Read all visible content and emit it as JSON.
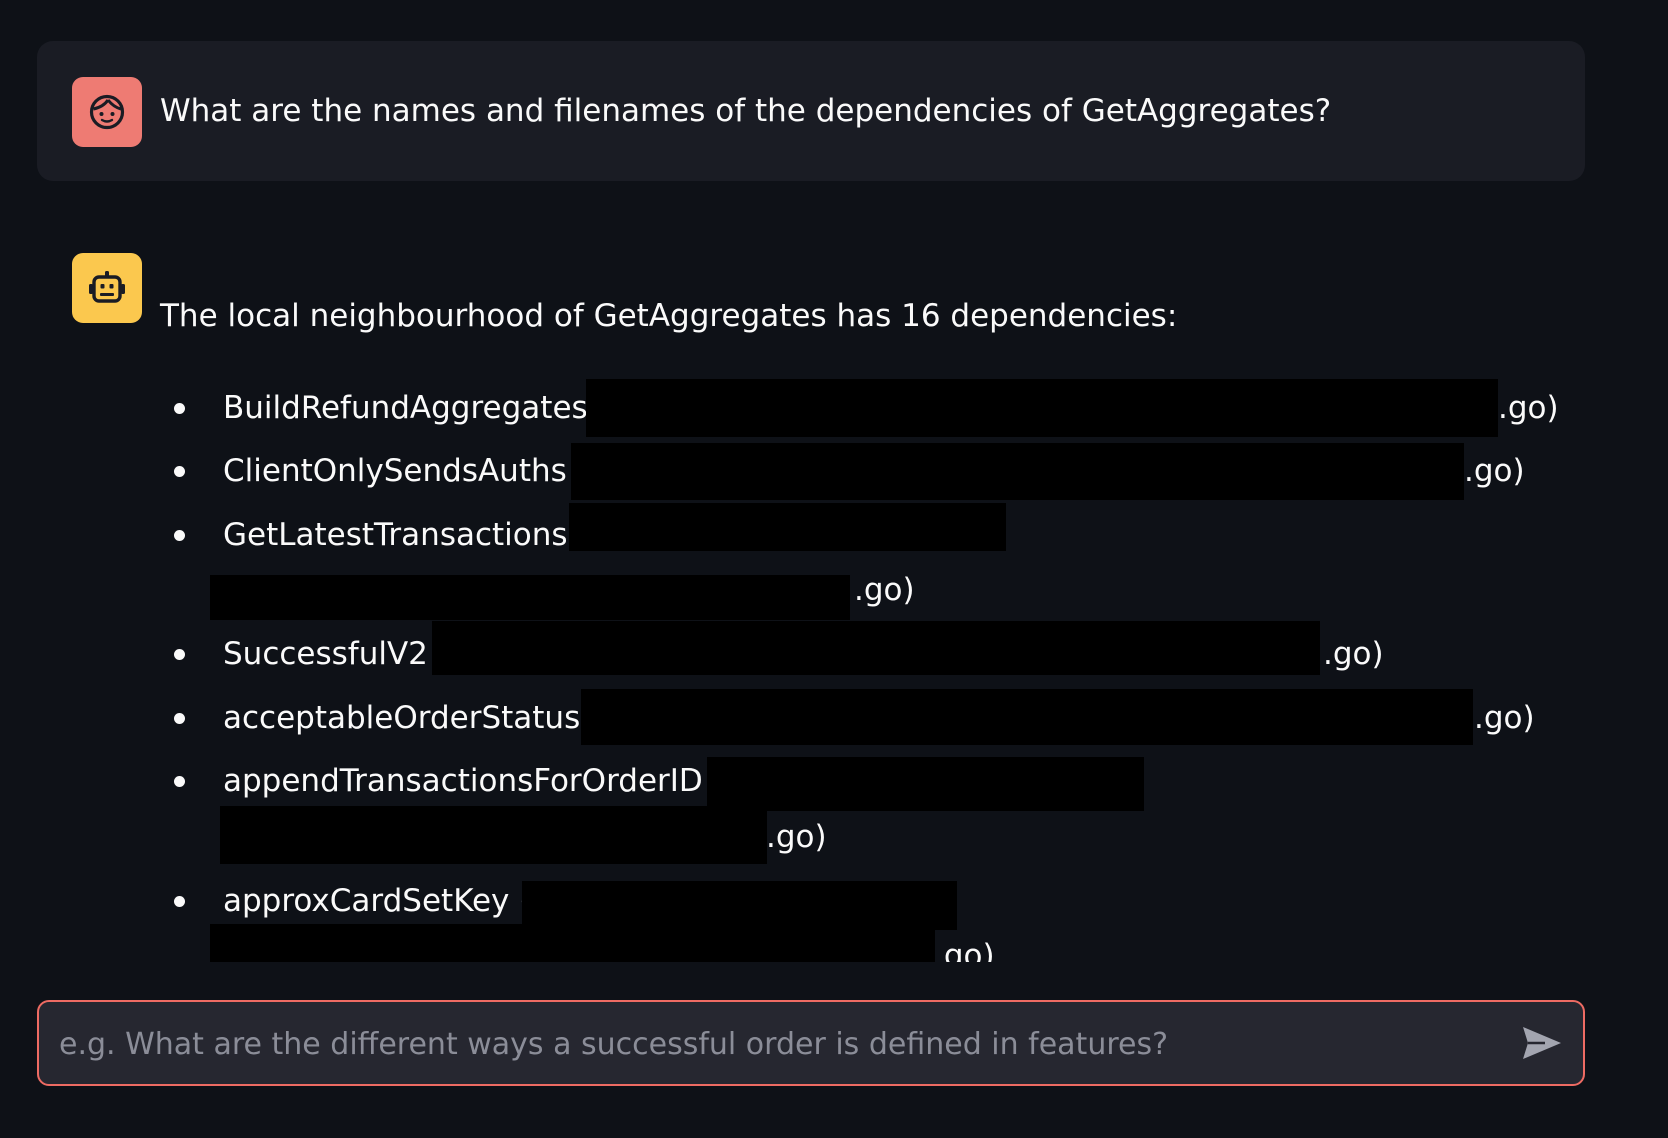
{
  "user_message": {
    "text": "What are the names and filenames of the dependencies of GetAggregates?"
  },
  "assistant_message": {
    "intro": "The local neighbourhood of GetAggregates has 16 dependencies:",
    "dependencies": [
      {
        "name": "BuildRefundAggregates (",
        "suffix": ".go)"
      },
      {
        "name": "ClientOnlySendsAuths (",
        "suffix": ".go)"
      },
      {
        "name": "GetLatestTransactions (",
        "suffix": ".go)"
      },
      {
        "name": "SuccessfulV2 (",
        "suffix": ".go)"
      },
      {
        "name": "acceptableOrderStatus (",
        "suffix": ".go)"
      },
      {
        "name": "appendTransactionsForOrderID (",
        "suffix": ".go)"
      },
      {
        "name": "approxCardSetKey (",
        "suffix": ".go)"
      }
    ]
  },
  "chat_input": {
    "placeholder": "e.g. What are the different ways a successful order is defined in features?",
    "value": ""
  },
  "icons": {
    "user_avatar": "user-face-icon",
    "bot_avatar": "robot-icon",
    "send": "send-arrow-icon"
  },
  "colors": {
    "background": "#0e1117",
    "user_bubble": "#1a1c24",
    "user_avatar": "#ee7b73",
    "bot_avatar": "#fbc84e",
    "input_border": "#ee6b63"
  }
}
